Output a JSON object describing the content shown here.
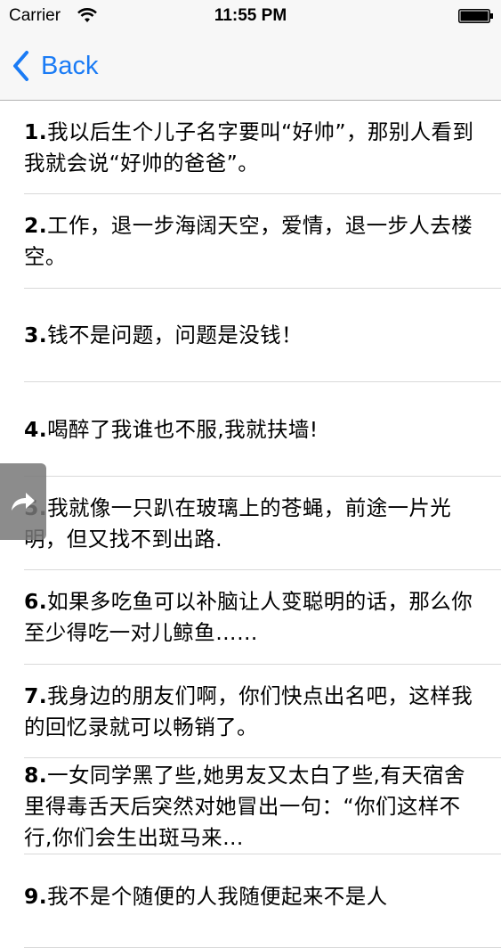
{
  "status_bar": {
    "carrier": "Carrier",
    "time": "11:55 PM"
  },
  "nav": {
    "back_label": "Back"
  },
  "colors": {
    "accent": "#1a7bf5",
    "separator": "#d9d9d9",
    "bar_background": "#f7f7f7"
  },
  "jokes": [
    {
      "num": "1.",
      "text": "我以后生个儿子名字要叫“好帅”，那别人看到我就会说“好帅的爸爸”。"
    },
    {
      "num": "2.",
      "text": "工作，退一步海阔天空，爱情，退一步人去楼空。"
    },
    {
      "num": "3.",
      "text": "钱不是问题，问题是没钱！"
    },
    {
      "num": "4.",
      "text": "喝醉了我谁也不服,我就扶墙!"
    },
    {
      "num": "5.",
      "text": "我就像一只趴在玻璃上的苍蝇，前途一片光明，但又找不到出路."
    },
    {
      "num": "6.",
      "text": "如果多吃鱼可以补脑让人变聪明的话，那么你至少得吃一对儿鲸鱼……"
    },
    {
      "num": "7.",
      "text": "我身边的朋友们啊，你们快点出名吧，这样我的回忆录就可以畅销了。"
    },
    {
      "num": "8.",
      "text": "一女同学黑了些,她男友又太白了些,有天宿舍里得毒舌天后突然对她冒出一句：“你们这样不行,你们会生出斑马来…"
    },
    {
      "num": "9.",
      "text": "我不是个随便的人我随便起来不是人"
    }
  ]
}
